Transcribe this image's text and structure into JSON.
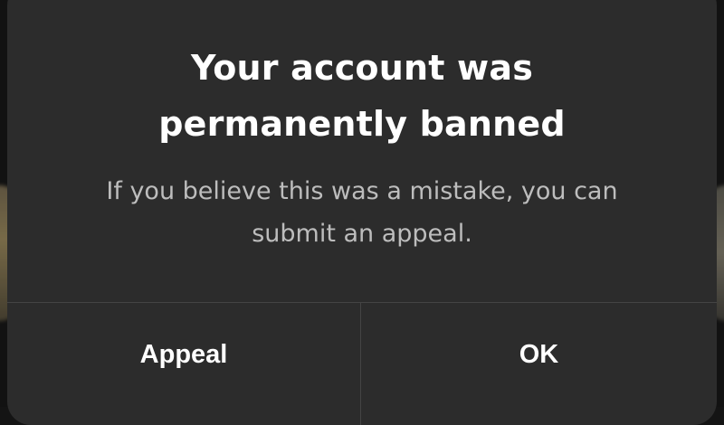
{
  "dialog": {
    "title_line1": "Your account was",
    "title_line2": "permanently banned",
    "message_line1": "If you believe this was a mistake, you can",
    "message_line2": "submit an appeal.",
    "buttons": {
      "appeal_label": "Appeal",
      "ok_label": "OK"
    }
  },
  "colors": {
    "modal_background": "#2c2c2c",
    "title_text": "#ffffff",
    "message_text": "#bdbdbd",
    "divider": "#444444",
    "button_text": "#ffffff"
  }
}
